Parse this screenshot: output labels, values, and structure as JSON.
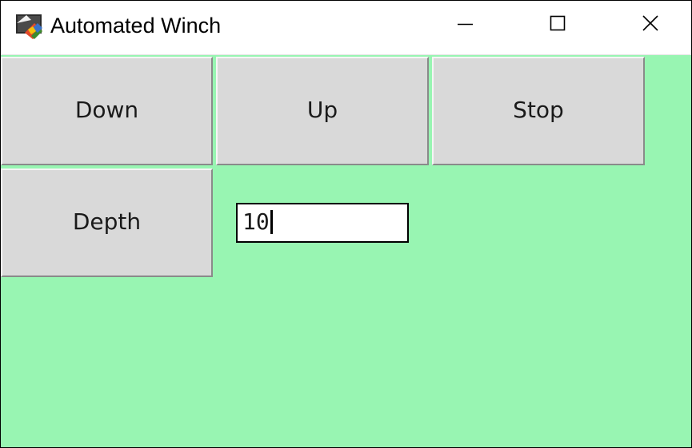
{
  "window": {
    "title": "Automated Winch",
    "background_color": "#98f5b2",
    "app_icon": "python-tk-icon",
    "controls": {
      "minimize": "minimize-icon",
      "maximize": "maximize-icon",
      "close": "close-icon"
    }
  },
  "buttons": {
    "down": "Down",
    "up": "Up",
    "stop": "Stop",
    "depth": "Depth"
  },
  "depth_input": {
    "value": "10"
  }
}
